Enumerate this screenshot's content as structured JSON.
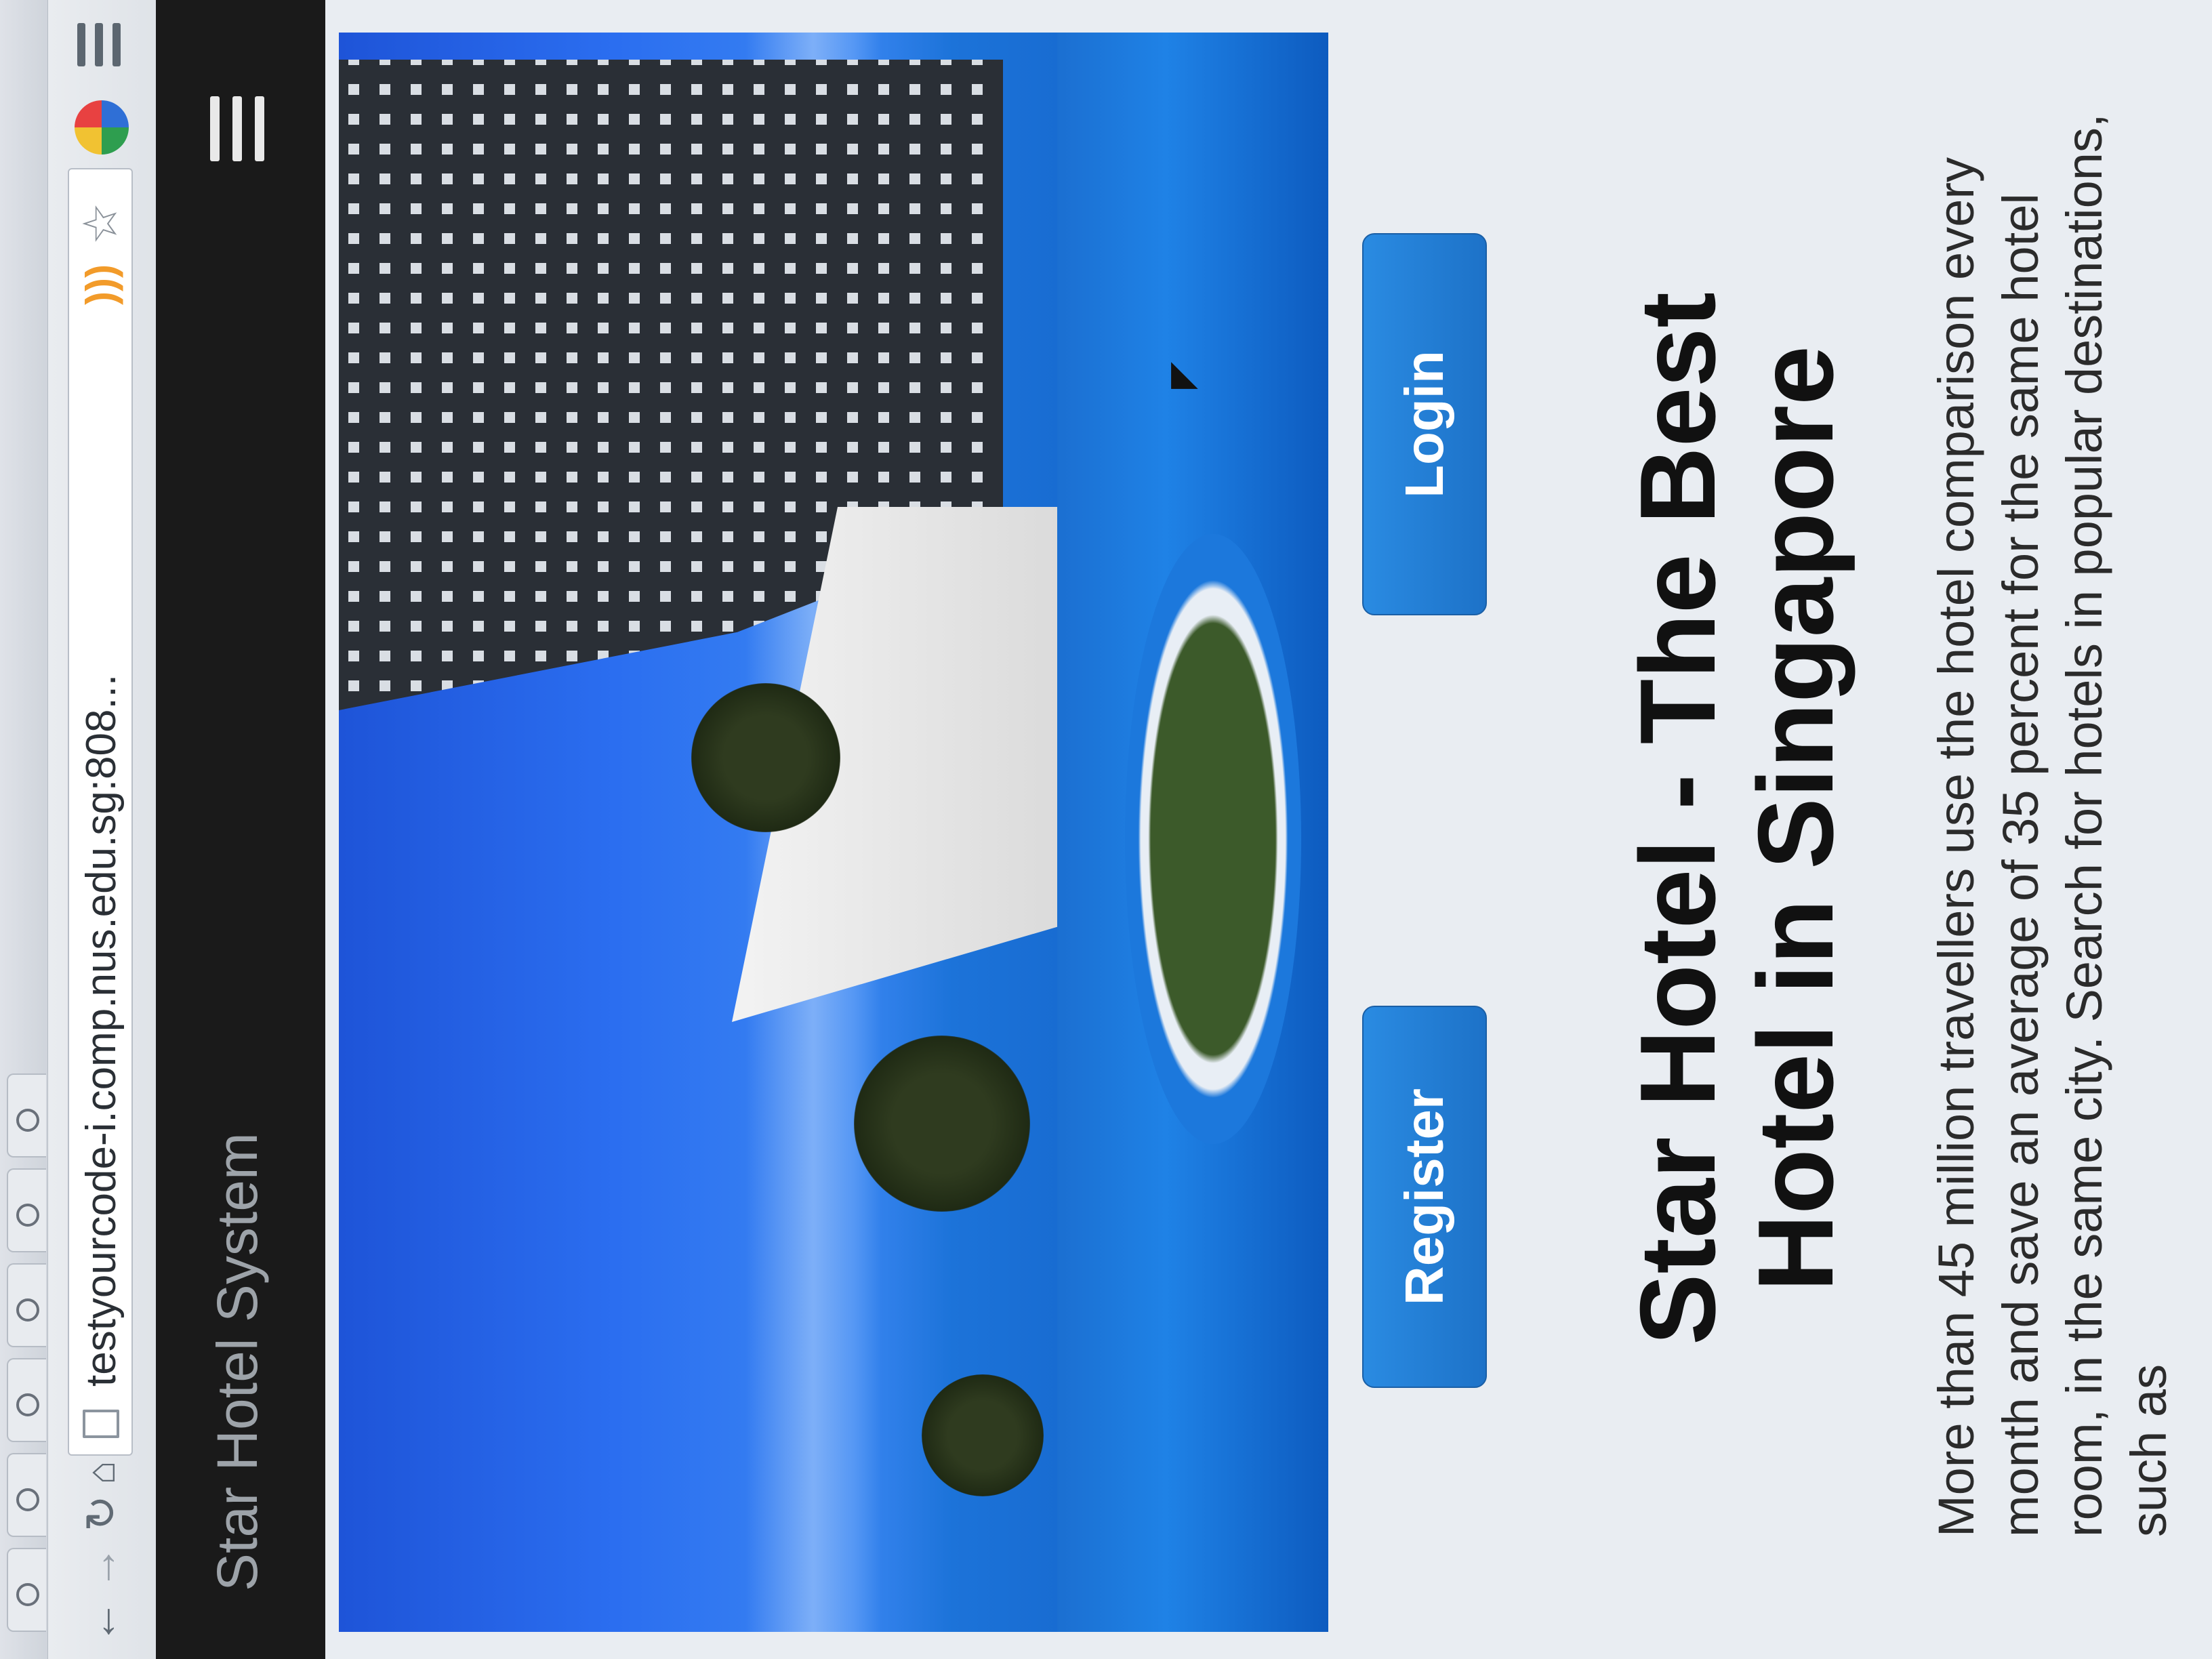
{
  "browser": {
    "url": "testyourcode-i.comp.nus.edu.sg:808...",
    "tab_count": 6
  },
  "navbar": {
    "brand": "Star Hotel System"
  },
  "hero": {
    "image_icon": "hotel-pool-photo",
    "register_label": "Register",
    "login_label": "Login",
    "headline": "Star Hotel - The Best Hotel in Singapore",
    "description": "More than 45 million travellers use the hotel comparison every month and save an average of 35 percent for the same hotel room, in the same city. Search for hotels in popular destinations, such as"
  },
  "colors": {
    "navbar_bg": "#1a1a1a",
    "button_bg": "#1f78cf",
    "page_bg": "#e9edf2"
  }
}
